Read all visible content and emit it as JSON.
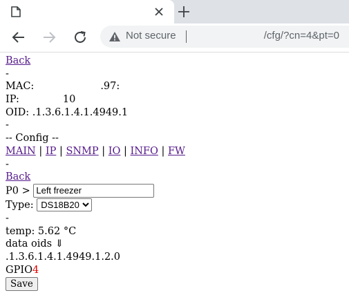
{
  "browser": {
    "tab_title": "",
    "security_label": "Not secure",
    "url": "/cfg/?cn=4&pt=0"
  },
  "page": {
    "back_label": "Back",
    "dash": "-",
    "mac_label": "MAC:",
    "mac_value": ".97:",
    "ip_label": "IP:",
    "ip_value": "10",
    "oid_label": "OID:",
    "oid_value": ".1.3.6.1.4.1.4949.1",
    "config_heading": "-- Config --",
    "nav_links": [
      "MAIN",
      "IP",
      "SNMP",
      "IO",
      "INFO",
      "FW"
    ],
    "separator": "|",
    "port_label": "P0 >",
    "port_name": "Left freezer",
    "type_label": "Type:",
    "type_selected": "DS18B20",
    "temp_line": "temp: 5.62 °C",
    "data_oids_label": "data oids ⇓",
    "data_oid_value": ".1.3.6.1.4.1.4949.1.2.0",
    "gpio_label": "GPIO",
    "gpio_number": "4",
    "save_label": "Save"
  }
}
